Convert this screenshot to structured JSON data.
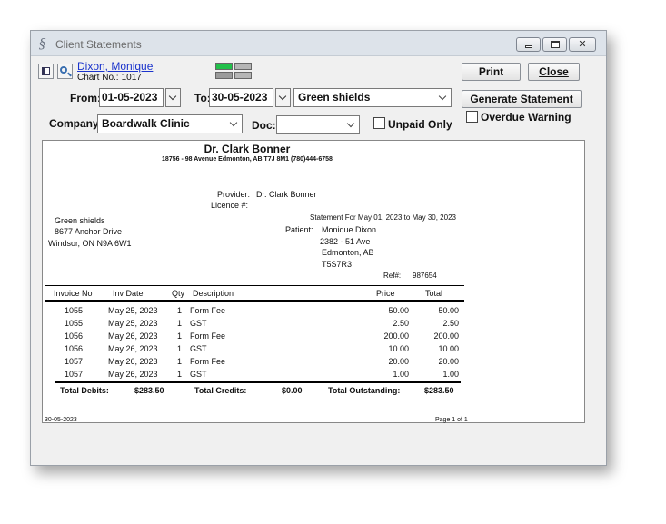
{
  "window": {
    "title": "Client Statements",
    "buttons": {
      "minimize": "minimize",
      "maximize": "maximize",
      "close": "✕"
    }
  },
  "patient": {
    "name": "Dixon, Monique",
    "chart_label": "Chart No.:",
    "chart_no": "1017"
  },
  "actions": {
    "print": "Print",
    "close": "Close",
    "generate": "Generate Statement"
  },
  "filters": {
    "from_label": "From:",
    "from_value": "01-05-2023",
    "to_label": "To:",
    "to_value": "30-05-2023",
    "payer_value": "Green shields",
    "company_label": "Company:",
    "company_value": "Boardwalk Clinic",
    "doc_label": "Doc:",
    "doc_value": "",
    "unpaid_only_label": "Unpaid Only",
    "unpaid_only_checked": false,
    "overdue_warning_label": "Overdue Warning",
    "overdue_warning_checked": false
  },
  "report": {
    "doctor": "Dr. Clark Bonner",
    "address_line": "18756 - 98 Avenue   Edmonton, AB   T7J 8M1   (780)444-6758",
    "provider_label": "Provider:",
    "provider_value": "Dr. Clark Bonner",
    "licence_label": "Licence #:",
    "payer": [
      "Green shields",
      "8677 Anchor Drive",
      "Windsor, ON  N9A 6W1"
    ],
    "statement_line": "Statement For May 01, 2023 to May 30, 2023",
    "patient_label": "Patient:",
    "patient_address": [
      "Monique Dixon",
      "2382 - 51 Ave",
      "Edmonton, AB",
      "T5S7R3"
    ],
    "ref_label": "Ref#:",
    "ref_value": "987654",
    "columns": [
      "Invoice No",
      "Inv Date",
      "Qty",
      "Description",
      "Price",
      "Total"
    ],
    "rows": [
      {
        "invoice": "1055",
        "date": "May 25, 2023",
        "qty": "1",
        "desc": "Form Fee",
        "price": "50.00",
        "total": "50.00"
      },
      {
        "invoice": "1055",
        "date": "May 25, 2023",
        "qty": "1",
        "desc": "GST",
        "price": "2.50",
        "total": "2.50"
      },
      {
        "invoice": "1056",
        "date": "May 26, 2023",
        "qty": "1",
        "desc": "Form Fee",
        "price": "200.00",
        "total": "200.00"
      },
      {
        "invoice": "1056",
        "date": "May 26, 2023",
        "qty": "1",
        "desc": "GST",
        "price": "10.00",
        "total": "10.00"
      },
      {
        "invoice": "1057",
        "date": "May 26, 2023",
        "qty": "1",
        "desc": "Form Fee",
        "price": "20.00",
        "total": "20.00"
      },
      {
        "invoice": "1057",
        "date": "May 26, 2023",
        "qty": "1",
        "desc": "GST",
        "price": "1.00",
        "total": "1.00"
      }
    ],
    "totals": {
      "debits_label": "Total Debits:",
      "debits_value": "$283.50",
      "credits_label": "Total Credits:",
      "credits_value": "$0.00",
      "outstanding_label": "Total Outstanding:",
      "outstanding_value": "$283.50"
    },
    "footer_date": "30-05-2023",
    "footer_page": "Page 1 of 1"
  }
}
